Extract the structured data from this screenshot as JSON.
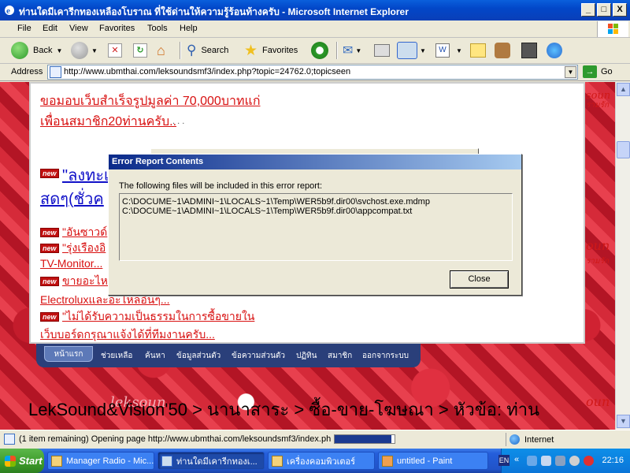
{
  "window": {
    "title": "ท่านใดมีเคารีกทองเหลืองโบราณ ที่ใช้ด่านให้ความรู้ร้อนท้างครับ - Microsoft Internet Explorer",
    "min": "_",
    "max": "□",
    "close": "X"
  },
  "menu": [
    "File",
    "Edit",
    "View",
    "Favorites",
    "Tools",
    "Help"
  ],
  "toolbar": {
    "back": "Back",
    "search": "Search",
    "favorites": "Favorites"
  },
  "address": {
    "label": "Address",
    "url": "http://www.ubmthai.com/leksoundsmf3/index.php?topic=24762.0;topicseen",
    "go": "Go"
  },
  "page": {
    "line1": "ขอมอบเว็บสำเร็จรูปมูลค่า 70,000บาทแก่",
    "line2": "เพื่อนสมาชิก20ท่านครับ..",
    "line2_dots": ". . .",
    "new_badge": "new",
    "blue1": "\"ลงทะเ",
    "blue2": "สดๆ(ชั่วค",
    "item1": "\"อันซาวด์",
    "item2": "\"รุ่งเรืองอิ",
    "item2b": "TV-Monitor...",
    "item3": "ขายอะไหล่",
    "item3b": "Electroluxและอะไหล่อื่นๆ...",
    "item4": "\"ไม่ได้รับความเป็นธรรมในการซื้อขายใน",
    "item4b": "เว็บบอร์ดกรุณาแจ้งได้ที่ทีมงานครับ...",
    "side1": "soun",
    "side2": "รามรัก",
    "side3": "oun",
    "side4": "รามรัก",
    "side5": "oun",
    "side6": "รามรัก",
    "breadcrumb": "LekSound&Vision'50 > นานาสาระ > ซื้อ-ขาย-โฆษณา > หัวข้อ: ท่าน",
    "bottom_brand_faint": "leksoun"
  },
  "nav": {
    "home": "หน้าแรก",
    "items": [
      "ช่วยเหลือ",
      "ค้นหา",
      "ข้อมูลส่วนตัว",
      "ข้อความส่วนตัว",
      "ปฏิทิน",
      "สมาชิก",
      "ออกจากระบบ"
    ]
  },
  "dialog": {
    "title": "Error Report Contents",
    "label": "The following files will be included in this error report:",
    "files": [
      "C:\\DOCUME~1\\ADMINI~1\\LOCALS~1\\Temp\\WER5b9f.dir00\\svchost.exe.mdmp",
      "C:\\DOCUME~1\\ADMINI~1\\LOCALS~1\\Temp\\WER5b9f.dir00\\appcompat.txt"
    ],
    "close": "Close"
  },
  "status": {
    "text": "(1 item remaining) Opening page http://www.ubmthai.com/leksoundsmf3/index.ph",
    "progress": 0.95,
    "zone": "Internet"
  },
  "taskbar": {
    "start": "Start",
    "tasks": [
      "Manager Radio - Mic...",
      "ท่านใดมีเคารีกทองเ...",
      "เครื่องคอมพิวเตอร์",
      "untitled - Paint"
    ],
    "lang": "EN",
    "clock": "22:16"
  },
  "colors": {
    "titlebar": "#0a4fd0",
    "link_red": "#d81010",
    "link_blue": "#1010c8",
    "nav_bg": "#2a3f7a"
  }
}
